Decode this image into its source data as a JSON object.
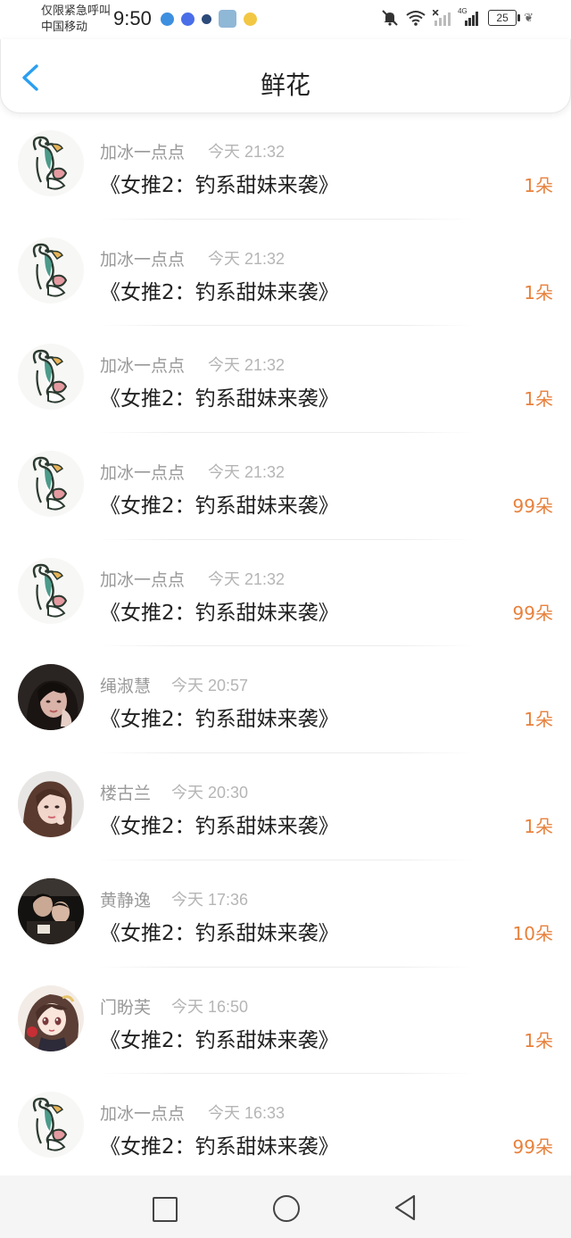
{
  "status_bar": {
    "carrier_line1": "仅限紧急呼叫",
    "carrier_line2": "中国移动",
    "time": "9:50",
    "network": "4G",
    "battery": "25",
    "icons": [
      "mute-bell-icon",
      "wifi-icon",
      "signal-icon",
      "battery-icon",
      "leaf-icon"
    ]
  },
  "header": {
    "title": "鲜花",
    "back_icon": "chevron-left-icon"
  },
  "colors": {
    "accent_blue": "#2a9ff0",
    "flower_orange": "#e8813c",
    "name_gray": "#999999",
    "time_gray": "#b5b5b5"
  },
  "rows": [
    {
      "name": "加冰一点点",
      "time": "今天 21:32",
      "title": "《女推2：钓系甜妹来袭》",
      "count": "1朵",
      "avatar": "duck-avatar"
    },
    {
      "name": "加冰一点点",
      "time": "今天 21:32",
      "title": "《女推2：钓系甜妹来袭》",
      "count": "1朵",
      "avatar": "duck-avatar"
    },
    {
      "name": "加冰一点点",
      "time": "今天 21:32",
      "title": "《女推2：钓系甜妹来袭》",
      "count": "1朵",
      "avatar": "duck-avatar"
    },
    {
      "name": "加冰一点点",
      "time": "今天 21:32",
      "title": "《女推2：钓系甜妹来袭》",
      "count": "99朵",
      "avatar": "duck-avatar"
    },
    {
      "name": "加冰一点点",
      "time": "今天 21:32",
      "title": "《女推2：钓系甜妹来袭》",
      "count": "99朵",
      "avatar": "duck-avatar"
    },
    {
      "name": "绳淑慧",
      "time": "今天 20:57",
      "title": "《女推2：钓系甜妹来袭》",
      "count": "1朵",
      "avatar": "photo-avatar"
    },
    {
      "name": "楼古兰",
      "time": "今天 20:30",
      "title": "《女推2：钓系甜妹来袭》",
      "count": "1朵",
      "avatar": "photo-avatar"
    },
    {
      "name": "黄静逸",
      "time": "今天 17:36",
      "title": "《女推2：钓系甜妹来袭》",
      "count": "10朵",
      "avatar": "photo-avatar"
    },
    {
      "name": "门盼芙",
      "time": "今天 16:50",
      "title": "《女推2：钓系甜妹来袭》",
      "count": "1朵",
      "avatar": "anime-avatar"
    },
    {
      "name": "加冰一点点",
      "time": "今天 16:33",
      "title": "《女推2：钓系甜妹来袭》",
      "count": "99朵",
      "avatar": "duck-avatar"
    }
  ],
  "nav_bar": {
    "icons": [
      "recents-square-icon",
      "home-circle-icon",
      "back-triangle-icon"
    ]
  }
}
